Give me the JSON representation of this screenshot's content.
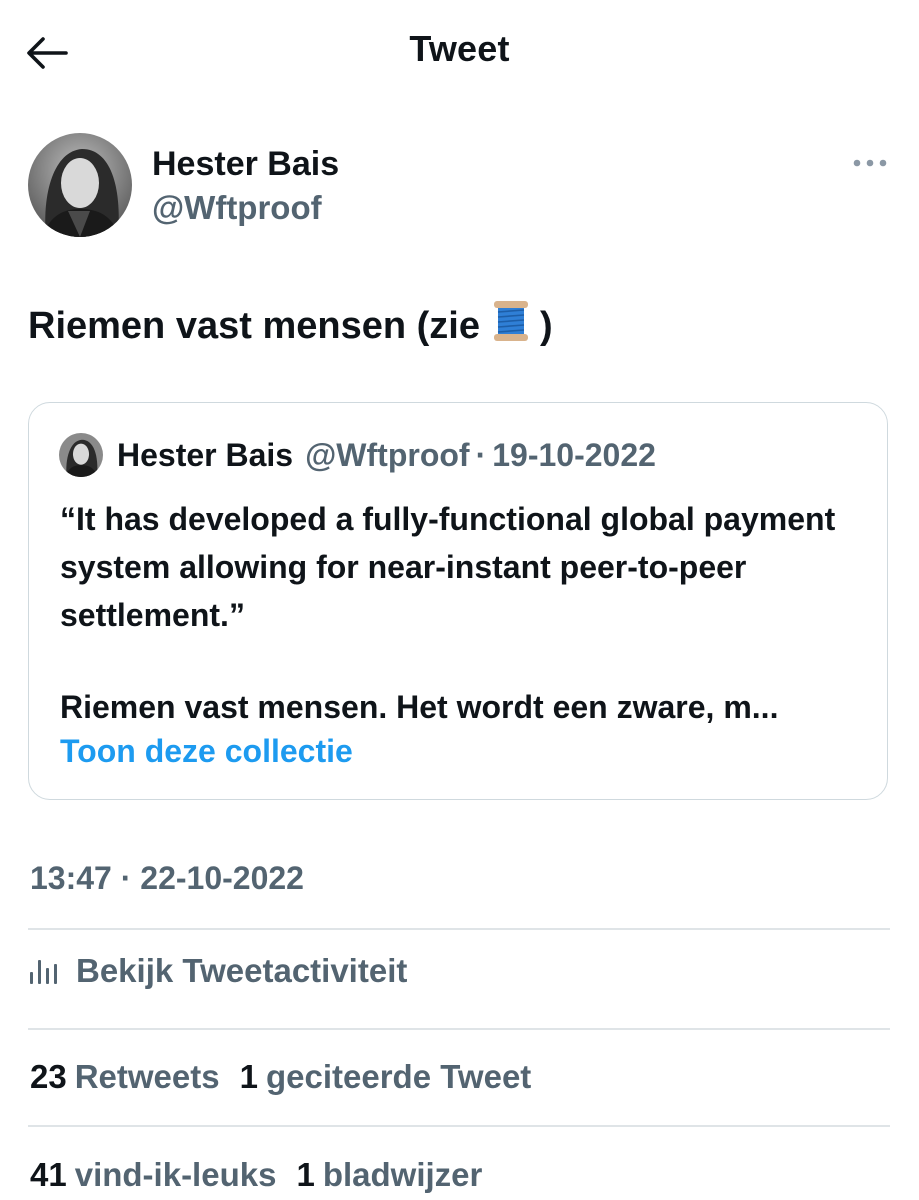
{
  "header": {
    "title": "Tweet",
    "back_icon": "arrow-left-icon"
  },
  "author": {
    "name": "Hester Bais",
    "handle": "@Wftproof"
  },
  "tweet": {
    "text": "Riemen vast mensen (zie",
    "emoji_icon": "spool-of-thread-icon",
    "text_end": ")"
  },
  "quote": {
    "name": "Hester Bais",
    "handle": "@Wftproof",
    "separator": "·",
    "date": "19-10-2022",
    "paragraph1": "“It has developed a fully-functional global payment system allowing for near-instant peer-to-peer settlement.”",
    "paragraph2": "Riemen vast mensen. Het wordt een zware, m...",
    "link": "Toon deze collectie"
  },
  "timestamp": {
    "time": "13:47",
    "separator": "·",
    "date": "22-10-2022"
  },
  "activity": {
    "label": "Bekijk Tweetactiviteit",
    "icon": "bar-chart-icon"
  },
  "stats": {
    "retweets_count": "23",
    "retweets_label": "Retweets",
    "quotes_count": "1",
    "quotes_label": "geciteerde Tweet",
    "likes_count": "41",
    "likes_label": "vind-ik-leuks",
    "bookmarks_count": "1",
    "bookmarks_label": "bladwijzer"
  },
  "colors": {
    "text": "#0f1419",
    "secondary": "#536471",
    "link": "#1d9bf0",
    "border": "#cfd9de"
  }
}
